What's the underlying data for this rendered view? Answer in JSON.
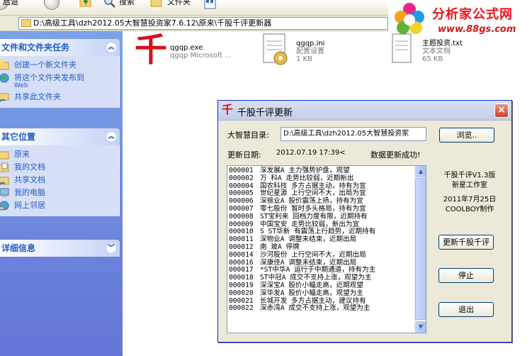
{
  "toolbar": {
    "left_label": "后退",
    "search_label": "搜索",
    "folders_label": "文件夹"
  },
  "address": {
    "path": "D:\\高级工具\\dzh2012.05大智慧投资家7.6.12\\原来\\千股千评更新器"
  },
  "brand": {
    "name": "分析家公式网",
    "url": "www.88gs.com"
  },
  "taskpane": {
    "file_tasks": {
      "title": "文件和文件夹任务",
      "items": [
        {
          "label": "创建一个新文件夹",
          "sub": ""
        },
        {
          "label": "将这个文件夹发布到",
          "sub": "Web"
        },
        {
          "label": "共享此文件夹",
          "sub": ""
        }
      ]
    },
    "other_places": {
      "title": "其它位置",
      "items": [
        {
          "label": "原来"
        },
        {
          "label": "我的文档"
        },
        {
          "label": "共享文档"
        },
        {
          "label": "我的电脑"
        },
        {
          "label": "网上邻居"
        }
      ]
    },
    "details": {
      "title": "详细信息"
    }
  },
  "files": [
    {
      "name": "qgqp.exe",
      "desc": "qgqp Microsoft ...",
      "size": ""
    },
    {
      "name": "qgqp.ini",
      "desc": "配置设置",
      "size": "1 KB"
    },
    {
      "name": "主题投资.txt",
      "desc": "文本文档",
      "size": "65 KB"
    }
  ],
  "file_icon_glyph": "千",
  "dialog": {
    "title_icon": "千",
    "title": "千股千评更新",
    "close": "×",
    "dir_label": "大智慧目录:",
    "dir_value": "D:\\高级工具\\dzh2012.05大智慧投资家",
    "browse_label": "浏览..",
    "update_date_label": "更新日期:",
    "update_date_value": "2012.07.19 17:39<",
    "status": "数据更新成功!",
    "info": {
      "version": "千股千评V1.3版",
      "studio": "新星工作室",
      "date": "2011年7月25日",
      "author": "COOLBOY制作"
    },
    "update_button": "更新千股千评",
    "stop_button": "停止",
    "exit_button": "退出",
    "rows": [
      {
        "code": "000001",
        "text": "深发展A 主力强势护盘，观望"
      },
      {
        "code": "000002",
        "text": "万 科A 走势比较弱，近期新出"
      },
      {
        "code": "000004",
        "text": "国农科技 多方占据主动，持有为宜"
      },
      {
        "code": "000005",
        "text": "世纪星源 上行空间不大，出局为宜"
      },
      {
        "code": "000006",
        "text": "深振业A 股价震荡上扬，持有为宜"
      },
      {
        "code": "000007",
        "text": "零七股份 暂时多头格局，持有为宜"
      },
      {
        "code": "000008",
        "text": "ST宝利来 回档力度有限，近期持有"
      },
      {
        "code": "000009",
        "text": "中国宝安 走势比较弱，新出为宜"
      },
      {
        "code": "000010",
        "text": "S ST华新 有震荡上行趋势，近期持有"
      },
      {
        "code": "000011",
        "text": "深物业A 调整未结束，近期出局"
      },
      {
        "code": "000012",
        "text": "南 玻A 停牌"
      },
      {
        "code": "000014",
        "text": "沙河股份 上行空间不大，近期出局"
      },
      {
        "code": "000016",
        "text": "深康佳A 调整未结束，近期出局"
      },
      {
        "code": "000017",
        "text": "*ST中华A 运行于中期通道，持有为主"
      },
      {
        "code": "000018",
        "text": "ST中冠A 成交不支持上涨，观望为主"
      },
      {
        "code": "000019",
        "text": "深深宝A 股价小幅走高，近期观望"
      },
      {
        "code": "000020",
        "text": "深华发A 股价小幅走高，观望为主"
      },
      {
        "code": "000021",
        "text": "长城开发 多方占据主动，建议持有"
      },
      {
        "code": "000022",
        "text": "深赤湾A 成交不支持上涨，观望为主"
      }
    ]
  }
}
